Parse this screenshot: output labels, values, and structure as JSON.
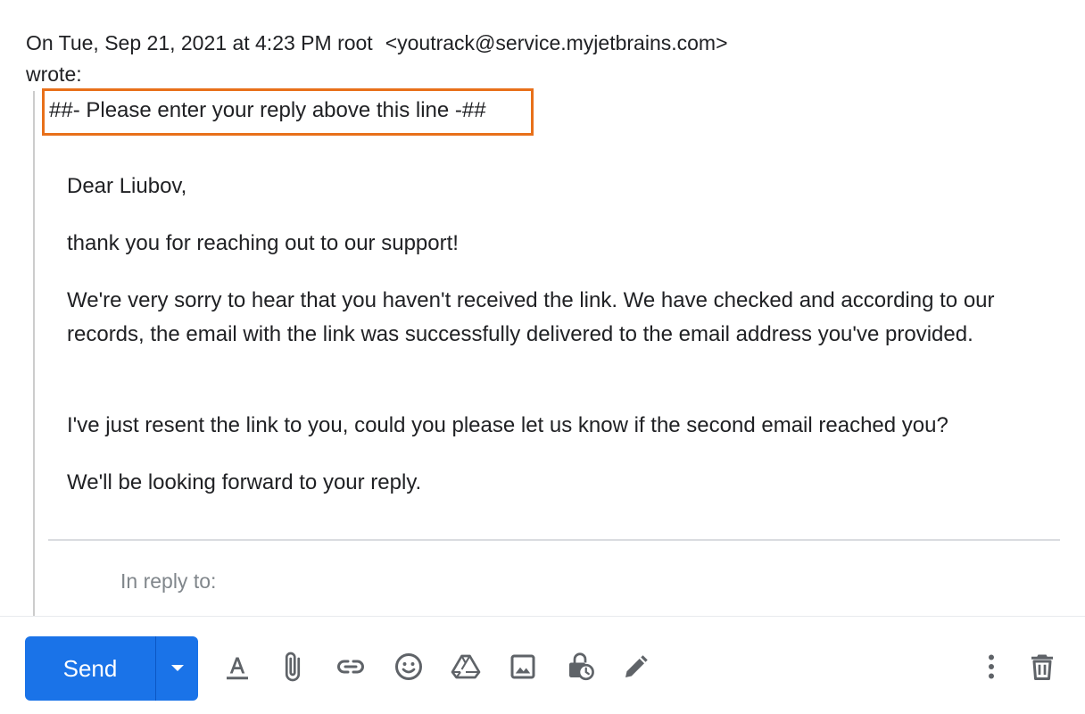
{
  "quote_header": {
    "prefix": "On Tue, Sep 21, 2021 at 4:23 PM root",
    "email": "<youtrack@service.myjetbrains.com>",
    "wrote": "wrote:"
  },
  "marker": "##- Please enter your reply above this line -##",
  "message": {
    "greeting": "Dear Liubov,",
    "thanks": "thank you for reaching out to our support!",
    "para1": "We're very sorry to hear that you haven't received the link. We have checked and according to our records, the email with the link was successfully delivered to the email address you've provided.",
    "para2": "I've just resent the link to you, could you please let us know if the second email reached you?",
    "para3": "We'll be looking forward to your reply."
  },
  "in_reply_to": "In reply to:",
  "toolbar": {
    "send_label": "Send",
    "icons": [
      "format-text-icon",
      "attach-icon",
      "link-icon",
      "emoji-icon",
      "drive-icon",
      "image-icon",
      "confidential-mode-icon",
      "signature-icon",
      "more-options-icon",
      "trash-icon"
    ]
  },
  "colors": {
    "accent": "#1a73e8",
    "marker_border": "#e8701a",
    "icon": "#5f6368"
  }
}
